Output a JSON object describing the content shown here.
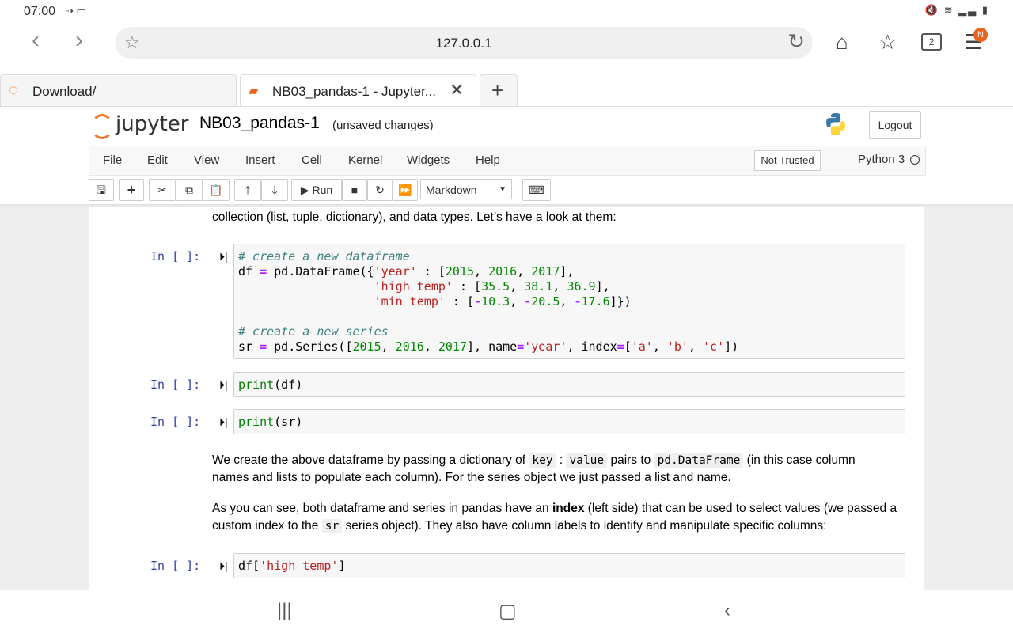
{
  "status": {
    "time": "07:00"
  },
  "browser": {
    "url": "127.0.0.1",
    "tabs_count": "2",
    "menu_badge": "N",
    "tabs": [
      {
        "label": "Download/"
      },
      {
        "label": "NB03_pandas-1 - Jupyter..."
      }
    ],
    "new_tab": "+"
  },
  "jupyter": {
    "logo_text": "jupyter",
    "notebook_name": "NB03_pandas-1",
    "save_status": "(unsaved changes)",
    "logout": "Logout",
    "menu": [
      "File",
      "Edit",
      "View",
      "Insert",
      "Cell",
      "Kernel",
      "Widgets",
      "Help"
    ],
    "trust": "Not Trusted",
    "kernel": "Python 3",
    "run_label": "Run",
    "cell_type": "Markdown"
  },
  "cells": {
    "intro_text": "collection (list, tuple, dictionary), and data types. Let’s have a look at them:",
    "prompt": "In [ ]:",
    "c1": {
      "comment1": "# create a new dataframe",
      "comment2": "# create a new series"
    },
    "c2": "print(df)",
    "c3": "print(sr)",
    "md1": {
      "t1": "We create the above dataframe by passing a dictionary of ",
      "code1": "key",
      "t2": " : ",
      "code2": "value",
      "t3": " pairs to ",
      "code3": "pd.DataFrame",
      "t4": " (in this case column names and lists to populate each column). For the series object we just passed a list and name."
    },
    "md2": {
      "t1": "As you can see, both dataframe and series in pandas have an ",
      "bold": "index",
      "t2": " (left side) that can be used to select values (we passed a custom index to the ",
      "code": "sr",
      "t3": " series object). They also have column labels to identify and manipulate specific columns:"
    }
  }
}
